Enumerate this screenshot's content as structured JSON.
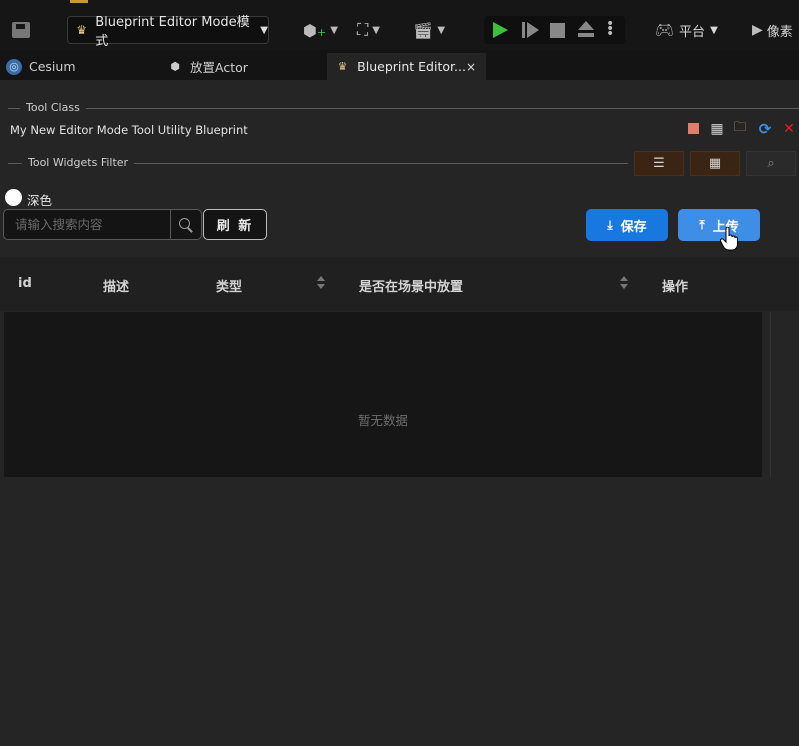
{
  "toolbar": {
    "mode_label": "Blueprint Editor Mode模式",
    "platform_label": "平台",
    "pixel_label": "像素"
  },
  "tabs": [
    {
      "label": "Cesium"
    },
    {
      "label": "放置Actor"
    },
    {
      "label": "Blueprint Editor...",
      "close": "×"
    }
  ],
  "panel": {
    "tool_class_label": "Tool Class",
    "tool_name": "My New Editor Mode Tool Utility Blueprint",
    "tool_widgets_filter_label": "Tool Widgets Filter"
  },
  "controls": {
    "dark_label": "深色",
    "search_placeholder": "请输入搜索内容",
    "refresh_label": "刷 新",
    "save_label": "保存",
    "upload_label": "上传"
  },
  "table": {
    "columns": [
      "id",
      "描述",
      "类型",
      "是否在场景中放置",
      "操作"
    ],
    "empty_text": "暂无数据"
  },
  "colors": {
    "primary": "#1977e0",
    "primary_hover": "#3f8ee6",
    "play_green": "#3cbf3c",
    "close_red": "#e02020"
  }
}
